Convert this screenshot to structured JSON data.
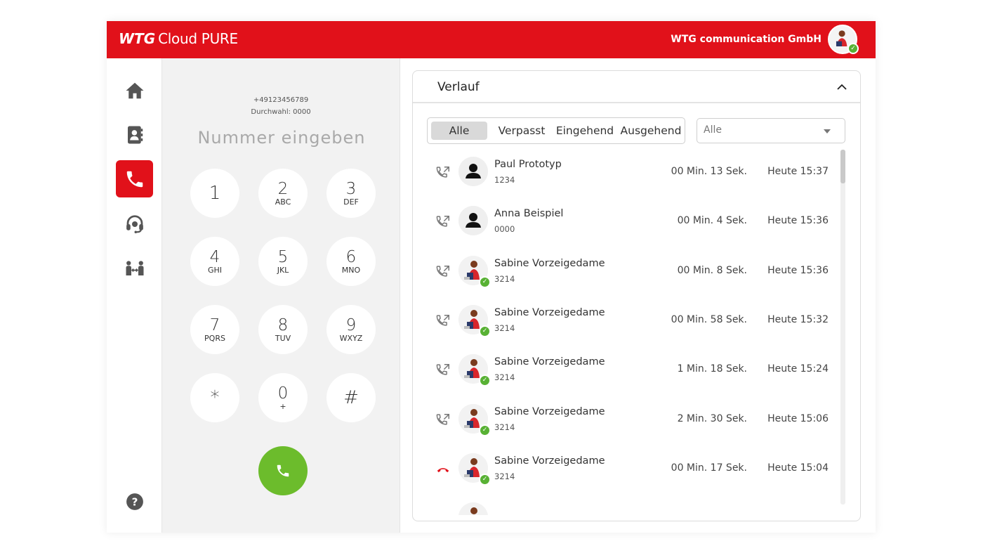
{
  "header": {
    "logo_brand": "WTG",
    "logo_product": "Cloud PURE",
    "company": "WTG communication GmbH",
    "user_status_icon": "check-icon"
  },
  "sidebar": {
    "items": [
      {
        "name": "home",
        "icon": "home-icon"
      },
      {
        "name": "contacts",
        "icon": "address-book-icon"
      },
      {
        "name": "phone",
        "icon": "phone-icon",
        "active": true
      },
      {
        "name": "support",
        "icon": "headset-icon"
      },
      {
        "name": "team",
        "icon": "people-transfer-icon"
      }
    ],
    "help_icon": "help-icon"
  },
  "dialpad": {
    "own_number": "+49123456789",
    "extension": "Durchwahl: 0000",
    "placeholder": "Nummer eingeben",
    "keys": [
      {
        "digit": "1",
        "letters": ""
      },
      {
        "digit": "2",
        "letters": "ABC"
      },
      {
        "digit": "3",
        "letters": "DEF"
      },
      {
        "digit": "4",
        "letters": "GHI"
      },
      {
        "digit": "5",
        "letters": "JKL"
      },
      {
        "digit": "6",
        "letters": "MNO"
      },
      {
        "digit": "7",
        "letters": "PQRS"
      },
      {
        "digit": "8",
        "letters": "TUV"
      },
      {
        "digit": "9",
        "letters": "WXYZ"
      },
      {
        "digit": "*",
        "letters": ""
      },
      {
        "digit": "0",
        "letters": "+"
      },
      {
        "digit": "#",
        "letters": ""
      }
    ]
  },
  "history": {
    "title": "Verlauf",
    "tabs": [
      "Alle",
      "Verpasst",
      "Eingehend",
      "Ausgehend"
    ],
    "active_tab": "Alle",
    "filter_value": "Alle",
    "calls": [
      {
        "name": "Paul Prototyp",
        "number": "1234",
        "duration": "00 Min. 13 Sek.",
        "time": "Heute 15:37",
        "type": "outgoing",
        "avatar": "person-icon"
      },
      {
        "name": "Anna Beispiel",
        "number": "0000",
        "duration": "00 Min. 4 Sek.",
        "time": "Heute 15:36",
        "type": "outgoing",
        "avatar": "person-icon"
      },
      {
        "name": "Sabine Vorzeigedame",
        "number": "3214",
        "duration": "00 Min. 8 Sek.",
        "time": "Heute 15:36",
        "type": "outgoing",
        "avatar": "photo"
      },
      {
        "name": "Sabine Vorzeigedame",
        "number": "3214",
        "duration": "00 Min. 58 Sek.",
        "time": "Heute 15:32",
        "type": "outgoing",
        "avatar": "photo"
      },
      {
        "name": "Sabine Vorzeigedame",
        "number": "3214",
        "duration": "1 Min. 18 Sek.",
        "time": "Heute 15:24",
        "type": "outgoing",
        "avatar": "photo"
      },
      {
        "name": "Sabine Vorzeigedame",
        "number": "3214",
        "duration": "2 Min. 30 Sek.",
        "time": "Heute 15:06",
        "type": "outgoing",
        "avatar": "photo"
      },
      {
        "name": "Sabine Vorzeigedame",
        "number": "3214",
        "duration": "00 Min. 17 Sek.",
        "time": "Heute 15:04",
        "type": "missed",
        "avatar": "photo"
      }
    ]
  },
  "colors": {
    "brand_red": "#e1111a",
    "call_green": "#6cbc2c",
    "status_green": "#58b134",
    "missed_red": "#e1111a",
    "icon_gray": "#555555"
  }
}
